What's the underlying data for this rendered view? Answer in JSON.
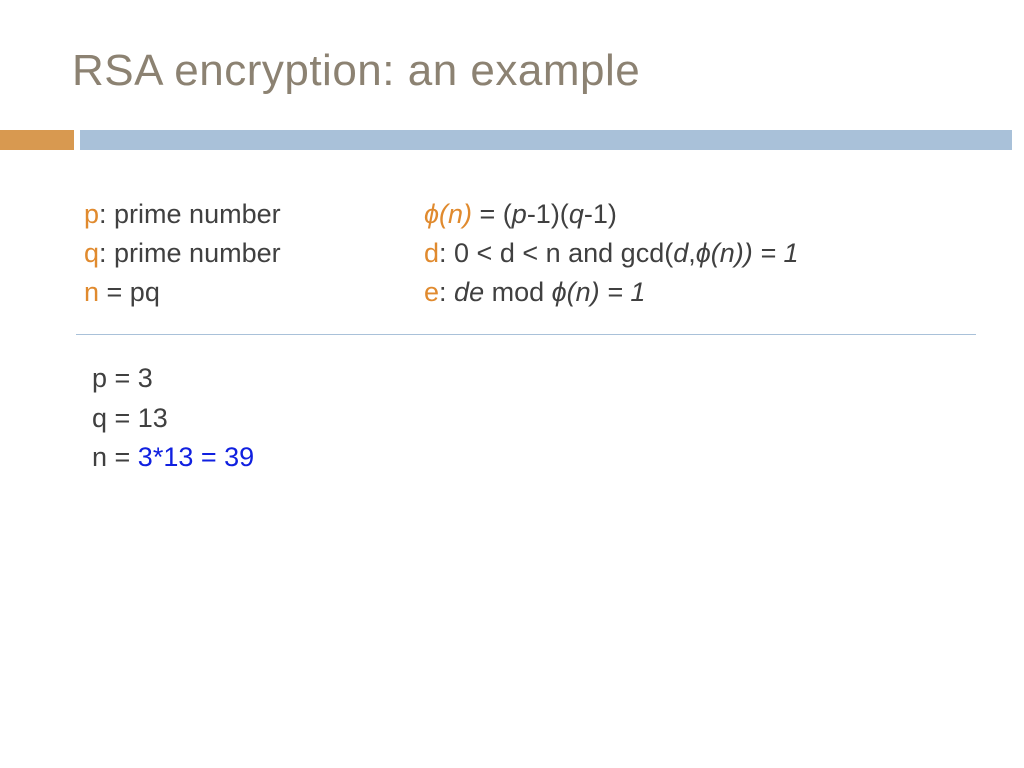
{
  "title": "RSA encryption: an example",
  "left": {
    "p_label": "p",
    "p_text": ": prime number",
    "q_label": "q",
    "q_text": ": prime number",
    "n_label": "n",
    "n_text": " = pq"
  },
  "right": {
    "phi_label": "ɸ(n)",
    "phi_eq": " = (",
    "phi_p": "p",
    "phi_mid1": "-1)(",
    "phi_q": "q",
    "phi_mid2": "-1)",
    "d_label": "d",
    "d_sep": ":   0 < d < n and gcd(",
    "d_d": "d",
    "d_comma": ",",
    "d_phi": "ɸ(n)",
    "d_tail": ") = 1",
    "e_label": "e",
    "e_sep": ":   ",
    "e_de": "de",
    "e_mod": " mod ",
    "e_phi": "ɸ(n)",
    "e_tail": " = 1"
  },
  "example": {
    "p": "p = 3",
    "q": "q = 13",
    "n_prefix": "n = ",
    "n_val": "3*13 = 39"
  }
}
